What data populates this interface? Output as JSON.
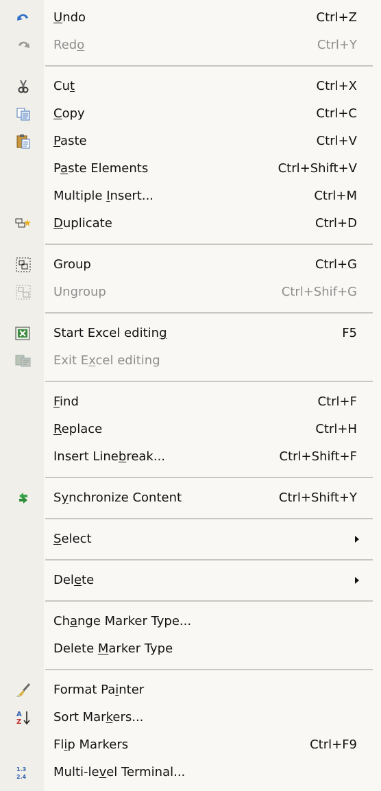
{
  "menu": {
    "undo": {
      "pre": "",
      "ul": "U",
      "post": "ndo",
      "shortcut": "Ctrl+Z",
      "icon": "undo-icon"
    },
    "redo": {
      "pre": "Red",
      "ul": "o",
      "post": "",
      "shortcut": "Ctrl+Y",
      "icon": "redo-icon"
    },
    "cut": {
      "pre": "Cu",
      "ul": "t",
      "post": "",
      "shortcut": "Ctrl+X",
      "icon": "scissors-icon"
    },
    "copy": {
      "pre": "",
      "ul": "C",
      "post": "opy",
      "shortcut": "Ctrl+C",
      "icon": "copy-icon"
    },
    "paste": {
      "pre": "",
      "ul": "P",
      "post": "aste",
      "shortcut": "Ctrl+V",
      "icon": "clipboard-icon"
    },
    "paste_elements": {
      "pre": "P",
      "ul": "a",
      "post": "ste Elements",
      "shortcut": "Ctrl+Shift+V"
    },
    "multiple_insert": {
      "pre": "Multiple ",
      "ul": "I",
      "post": "nsert...",
      "shortcut": "Ctrl+M"
    },
    "duplicate": {
      "pre": "",
      "ul": "D",
      "post": "uplicate",
      "shortcut": "Ctrl+D",
      "icon": "duplicate-icon"
    },
    "group": {
      "pre": "Group",
      "ul": "",
      "post": "",
      "shortcut": "Ctrl+G",
      "icon": "group-icon"
    },
    "ungroup": {
      "pre": "Ungroup",
      "ul": "",
      "post": "",
      "shortcut": "Ctrl+Shif+G",
      "icon": "ungroup-icon"
    },
    "start_excel": {
      "pre": "Start Excel editin",
      "ul": "g",
      "post": "",
      "shortcut": "F5",
      "icon": "excel-icon"
    },
    "exit_excel": {
      "pre": "Exit E",
      "ul": "x",
      "post": "cel editing",
      "shortcut": "",
      "icon": "excel-exit-icon"
    },
    "find": {
      "pre": "",
      "ul": "F",
      "post": "ind",
      "shortcut": "Ctrl+F"
    },
    "replace": {
      "pre": "",
      "ul": "R",
      "post": "eplace",
      "shortcut": "Ctrl+H"
    },
    "insert_linebreak": {
      "pre": "Insert Line",
      "ul": "b",
      "post": "reak...",
      "shortcut": "Ctrl+Shift+F"
    },
    "synchronize": {
      "pre": "S",
      "ul": "y",
      "post": "nchronize Content",
      "shortcut": "Ctrl+Shift+Y",
      "icon": "sync-icon"
    },
    "select": {
      "pre": "",
      "ul": "S",
      "post": "elect",
      "shortcut": ""
    },
    "delete": {
      "pre": "Del",
      "ul": "e",
      "post": "te",
      "shortcut": ""
    },
    "change_marker": {
      "pre": "Ch",
      "ul": "a",
      "post": "nge Marker Type...",
      "shortcut": ""
    },
    "delete_marker": {
      "pre": "Delete ",
      "ul": "M",
      "post": "arker Type",
      "shortcut": ""
    },
    "format_painter": {
      "pre": "Format Pa",
      "ul": "i",
      "post": "nter",
      "shortcut": "",
      "icon": "paintbrush-icon"
    },
    "sort_markers": {
      "pre": "Sort Mar",
      "ul": "k",
      "post": "ers...",
      "shortcut": "",
      "icon": "sort-az-icon"
    },
    "flip_markers": {
      "pre": "Fl",
      "ul": "i",
      "post": "p Markers",
      "shortcut": "Ctrl+F9"
    },
    "multi_level": {
      "pre": "Multi-le",
      "ul": "v",
      "post": "el Terminal...",
      "shortcut": "",
      "icon": "multi-level-icon"
    }
  },
  "colors": {
    "gutter": "#f1efe9",
    "background": "#f9f8f5",
    "separator": "#c9c7c1",
    "disabled": "#8e8e8e"
  }
}
